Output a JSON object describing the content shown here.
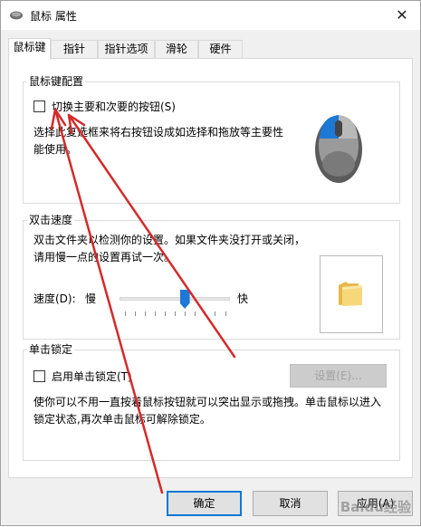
{
  "window": {
    "title": "鼠标 属性",
    "close_glyph": "✕"
  },
  "tabs": [
    {
      "label": "鼠标键",
      "active": true
    },
    {
      "label": "指针",
      "active": false
    },
    {
      "label": "指针选项",
      "active": false
    },
    {
      "label": "滑轮",
      "active": false
    },
    {
      "label": "硬件",
      "active": false
    }
  ],
  "button_config": {
    "group_title": "鼠标键配置",
    "switch_label": "切换主要和次要的按钮(S)",
    "switch_checked": false,
    "description": "选择此复选框来将右按钮设成如选择和拖放等主要性能使用。"
  },
  "double_click": {
    "group_title": "双击速度",
    "description": "双击文件夹以检测你的设置。如果文件夹没打开或关闭，请用慢一点的设置再试一次。",
    "speed_label": "速度(D):",
    "slow_label": "慢",
    "fast_label": "快",
    "speed_level": 0.6
  },
  "click_lock": {
    "group_title": "单击锁定",
    "enable_label": "启用单击锁定(T)",
    "enable_checked": false,
    "settings_label": "设置(E)...",
    "description": "使你可以不用一直按着鼠标按钮就可以突出显示或拖拽。单击鼠标以进入锁定状态,再次单击鼠标可解除锁定。"
  },
  "footer": {
    "ok_label": "确定",
    "cancel_label": "取消",
    "apply_label": "应用(A)"
  },
  "watermark": "Baidu经验",
  "colors": {
    "accent": "#0078d7",
    "annotation_arrow": "#d42a2a"
  }
}
